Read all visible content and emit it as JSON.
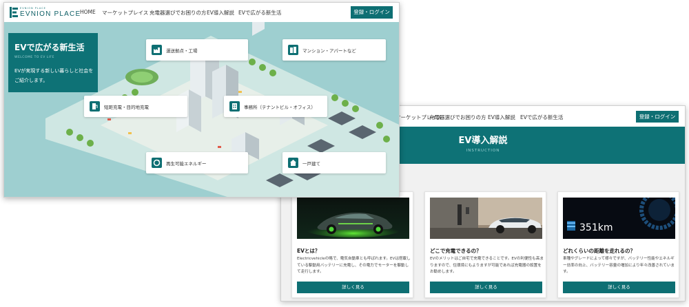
{
  "back_window": {
    "nav": {
      "links": [
        "マーケットプレイス",
        "充電器選びでお困りの方",
        "EV導入解説",
        "EVで広がる新生活"
      ],
      "login_label": "登録・ログイン"
    },
    "banner": {
      "title": "EV導入解説",
      "subtitle": "INSTRUCTION"
    },
    "cards": [
      {
        "title": "EVとは？",
        "text": "Electricvehicleの略で、電気自動車とも呼ばれます。EVは搭載している駆動用バッテリーに充電し、その電力でモーターを駆動して走行します。",
        "button": "詳しく見る"
      },
      {
        "title": "どこで充電できるの？",
        "text": "EVのメリットはご自宅で充電できることです。EVの利便性も高まりますので、住環境にもよりますが可能であれば充電器の設置をお勧めします。",
        "button": "詳しく見る"
      },
      {
        "title": "どれくらいの距離を走れるの？",
        "text": "車種やグレードによって様々ですが、バッテリー性能やエネルギー効率の向上、バッテリー容量の増加により年々改善されています。",
        "button": "詳しく見る",
        "photo_readout": "351km"
      }
    ]
  },
  "front_window": {
    "logo": {
      "small": "EVNION PLACE",
      "text": "EVNION PLACE"
    },
    "nav": {
      "links": [
        "HOME",
        "マーケットプレイス",
        "充電器選びでお困りの方",
        "EV導入解説",
        "EVで広がる新生活"
      ],
      "login_label": "登録・ログイン"
    },
    "hero": {
      "title": "EVで広がる新生活",
      "subtitle": "WELCOME TO EV LIFE",
      "text": "EVが実現する新しい暮らしと社会をご紹介します。"
    },
    "poi_labels": [
      "運送拠点・工場",
      "マンション・アパートなど",
      "短距充電・目的地充電",
      "事務所（テナントビル・オフィス）",
      "再生可能エネルギー",
      "一戸建て"
    ]
  },
  "colors": {
    "accent": "#0e6f73",
    "hero_bg": "#9ecfd0",
    "card_bg": "#ffffff"
  },
  "icons": [
    "ev-logo-icon",
    "factory-icon",
    "apartment-icon",
    "charger-icon",
    "office-icon",
    "renewable-icon",
    "house-icon"
  ]
}
